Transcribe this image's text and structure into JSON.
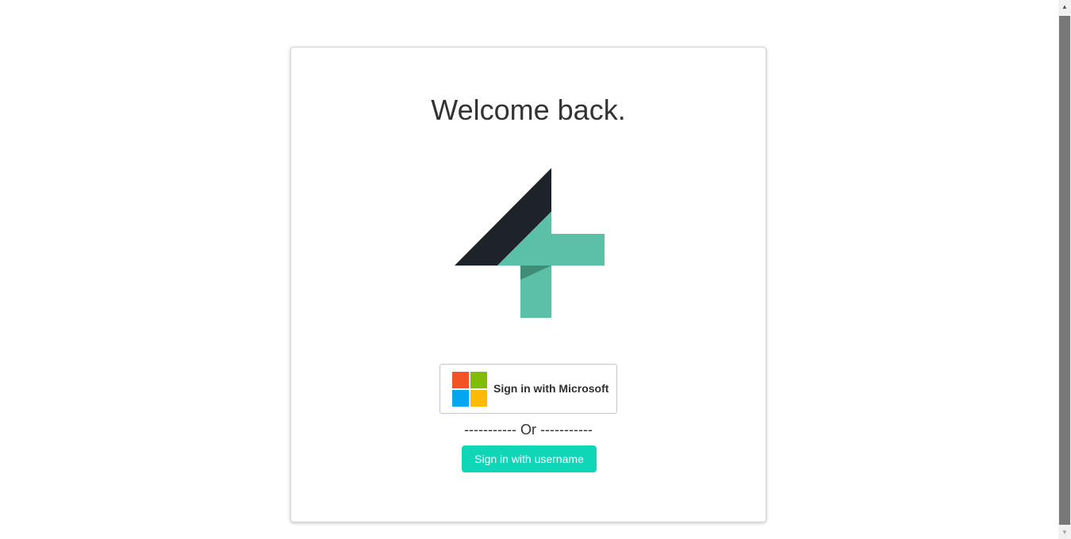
{
  "card": {
    "title": "Welcome back."
  },
  "logo": {
    "icon": "four-plus-logo",
    "colors": {
      "dark": "#1e2329",
      "teal": "#5cc0a6",
      "teal_shadow": "#3f8c77"
    }
  },
  "microsoft_button": {
    "label": "Sign in with Microsoft",
    "icon": "microsoft-logo-icon",
    "colors": [
      "#f35325",
      "#81bc06",
      "#05a6f0",
      "#ffba08"
    ]
  },
  "divider": {
    "text": "----------- Or -----------"
  },
  "username_button": {
    "label": "Sign in with username",
    "color": "#0fd6b7"
  },
  "scrollbar": {
    "up_icon": "scroll-up-arrow-icon",
    "down_icon": "scroll-down-arrow-icon"
  }
}
